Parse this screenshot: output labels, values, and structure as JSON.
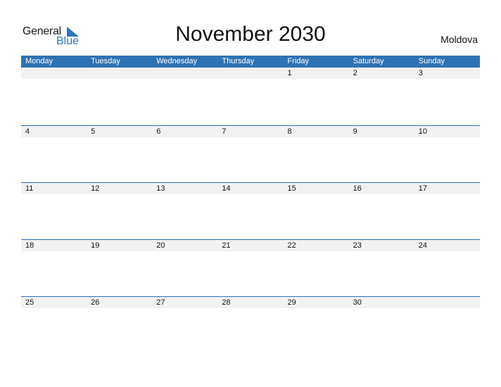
{
  "logo": {
    "text_general": "General",
    "text_blue": "Blue",
    "icon": "triangle-flag-icon"
  },
  "title": "November 2030",
  "country": "Moldova",
  "colors": {
    "header_bg": "#2e72b3",
    "logo_blue": "#2c75c0",
    "day_row_bg": "#f2f2f2"
  },
  "weekdays": [
    "Monday",
    "Tuesday",
    "Wednesday",
    "Thursday",
    "Friday",
    "Saturday",
    "Sunday"
  ],
  "weeks": [
    [
      "",
      "",
      "",
      "",
      "1",
      "2",
      "3"
    ],
    [
      "4",
      "5",
      "6",
      "7",
      "8",
      "9",
      "10"
    ],
    [
      "11",
      "12",
      "13",
      "14",
      "15",
      "16",
      "17"
    ],
    [
      "18",
      "19",
      "20",
      "21",
      "22",
      "23",
      "24"
    ],
    [
      "25",
      "26",
      "27",
      "28",
      "29",
      "30",
      ""
    ]
  ]
}
